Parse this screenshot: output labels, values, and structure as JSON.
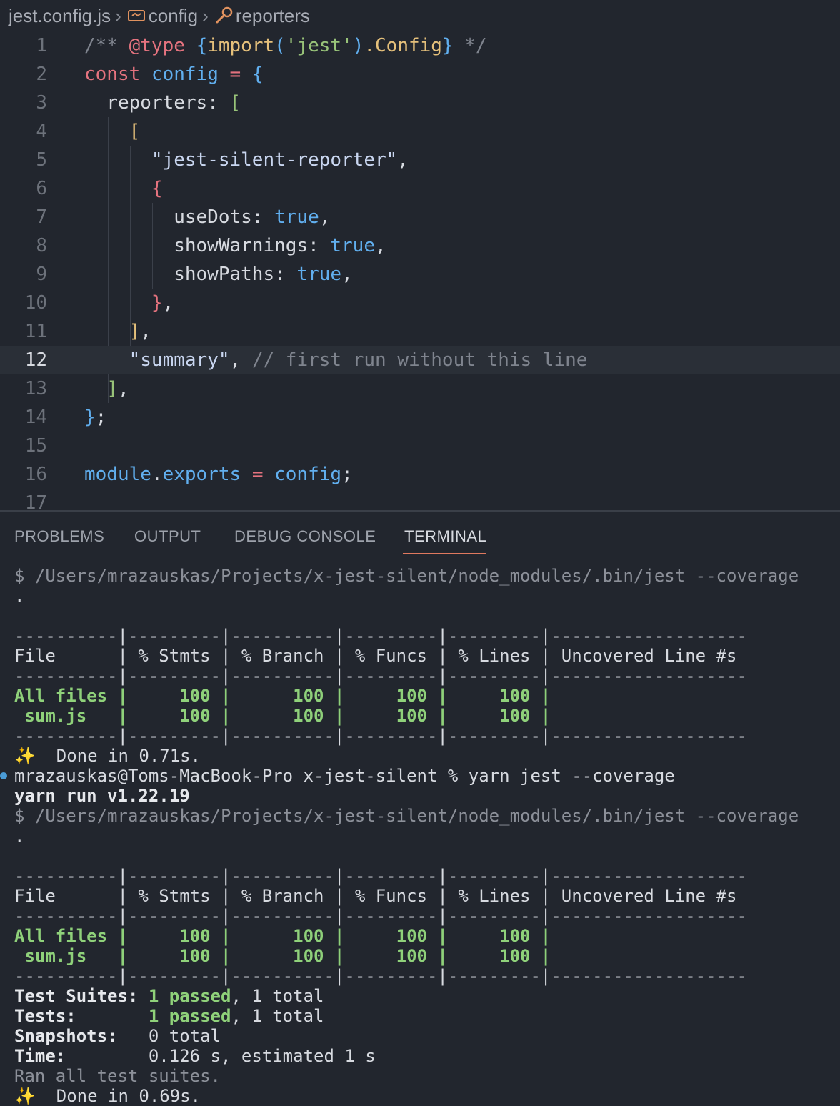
{
  "breadcrumb": {
    "file": "jest.config.js",
    "symbol1": "config",
    "symbol2": "reporters",
    "file_icon": "file-icon",
    "variable_icon": "variable-icon",
    "property_icon": "wrench-icon"
  },
  "editor": {
    "current_line": 12,
    "lines": [
      {
        "n": "1",
        "tokens": [
          [
            "c-comment",
            "/** "
          ],
          [
            "c-tag",
            "@type"
          ],
          [
            "c-comment",
            " "
          ],
          [
            "c-brace",
            "{"
          ],
          [
            "c-type",
            "import"
          ],
          [
            "c-brace",
            "("
          ],
          [
            "c-str",
            "'jest'"
          ],
          [
            "c-brace",
            ")"
          ],
          [
            "c-type",
            ".Config"
          ],
          [
            "c-brace",
            "}"
          ],
          [
            "c-comment",
            " */"
          ]
        ]
      },
      {
        "n": "2",
        "tokens": [
          [
            "c-kw",
            "const"
          ],
          [
            "c-op",
            " "
          ],
          [
            "c-var",
            "config"
          ],
          [
            "c-op",
            " "
          ],
          [
            "c-kw",
            "="
          ],
          [
            "c-op",
            " "
          ],
          [
            "c-brace",
            "{"
          ]
        ]
      },
      {
        "n": "3",
        "tokens": [
          [
            "c-op",
            "  reporters: "
          ],
          [
            "c-br3",
            "["
          ]
        ]
      },
      {
        "n": "4",
        "tokens": [
          [
            "c-op",
            "    "
          ],
          [
            "c-br1",
            "["
          ]
        ]
      },
      {
        "n": "5",
        "tokens": [
          [
            "c-op",
            "      "
          ],
          [
            "c-strw",
            "\"jest-silent-reporter\""
          ],
          [
            "c-op",
            ","
          ]
        ]
      },
      {
        "n": "6",
        "tokens": [
          [
            "c-op",
            "      "
          ],
          [
            "c-br2",
            "{"
          ]
        ]
      },
      {
        "n": "7",
        "tokens": [
          [
            "c-prop",
            "        useDots: "
          ],
          [
            "c-bool",
            "true"
          ],
          [
            "c-op",
            ","
          ]
        ]
      },
      {
        "n": "8",
        "tokens": [
          [
            "c-prop",
            "        showWarnings: "
          ],
          [
            "c-bool",
            "true"
          ],
          [
            "c-op",
            ","
          ]
        ]
      },
      {
        "n": "9",
        "tokens": [
          [
            "c-prop",
            "        showPaths: "
          ],
          [
            "c-bool",
            "true"
          ],
          [
            "c-op",
            ","
          ]
        ]
      },
      {
        "n": "10",
        "tokens": [
          [
            "c-op",
            "      "
          ],
          [
            "c-br2",
            "}"
          ],
          [
            "c-op",
            ","
          ]
        ]
      },
      {
        "n": "11",
        "tokens": [
          [
            "c-op",
            "    "
          ],
          [
            "c-br1",
            "]"
          ],
          [
            "c-op",
            ","
          ]
        ]
      },
      {
        "n": "12",
        "tokens": [
          [
            "c-op",
            "    "
          ],
          [
            "c-strw",
            "\"summary\""
          ],
          [
            "c-op",
            ", "
          ],
          [
            "c-comment",
            "// first run without this line"
          ]
        ]
      },
      {
        "n": "13",
        "tokens": [
          [
            "c-op",
            "  "
          ],
          [
            "c-br3",
            "]"
          ],
          [
            "c-op",
            ","
          ]
        ]
      },
      {
        "n": "14",
        "tokens": [
          [
            "c-brace",
            "}"
          ],
          [
            "c-op",
            ";"
          ]
        ]
      },
      {
        "n": "15",
        "tokens": []
      },
      {
        "n": "16",
        "tokens": [
          [
            "c-var",
            "module"
          ],
          [
            "c-op",
            "."
          ],
          [
            "c-var",
            "exports"
          ],
          [
            "c-op",
            " "
          ],
          [
            "c-kw",
            "="
          ],
          [
            "c-op",
            " "
          ],
          [
            "c-var",
            "config"
          ],
          [
            "c-op",
            ";"
          ]
        ]
      },
      {
        "n": "17",
        "tokens": []
      }
    ]
  },
  "panel": {
    "tabs": [
      "PROBLEMS",
      "OUTPUT",
      "DEBUG CONSOLE",
      "TERMINAL"
    ],
    "active_tab": "TERMINAL"
  },
  "terminal": {
    "accent_green": "#8fd17a",
    "lines": [
      {
        "t": "dim",
        "text": "$ /Users/mrazauskas/Projects/x-jest-silent/node_modules/.bin/jest --coverage"
      },
      {
        "t": "plain",
        "text": "."
      },
      {
        "t": "plain",
        "text": ""
      },
      {
        "t": "plain",
        "text": "----------|---------|----------|---------|---------|-------------------"
      },
      {
        "t": "plain",
        "text": "File      | % Stmts | % Branch | % Funcs | % Lines | Uncovered Line #s"
      },
      {
        "t": "plain",
        "text": "----------|---------|----------|---------|---------|-------------------"
      },
      {
        "t": "green",
        "text": "All files |     100 |      100 |     100 |     100 |"
      },
      {
        "t": "green",
        "text": " sum.js   |     100 |      100 |     100 |     100 |"
      },
      {
        "t": "plain",
        "text": "----------|---------|----------|---------|---------|-------------------"
      },
      {
        "t": "plain",
        "text": "✨  Done in 0.71s."
      },
      {
        "t": "prompt",
        "text": "mrazauskas@Toms-MacBook-Pro x-jest-silent % yarn jest --coverage"
      },
      {
        "t": "bold",
        "text": "yarn run v1.22.19"
      },
      {
        "t": "dim",
        "text": "$ /Users/mrazauskas/Projects/x-jest-silent/node_modules/.bin/jest --coverage"
      },
      {
        "t": "plain",
        "text": "."
      },
      {
        "t": "plain",
        "text": ""
      },
      {
        "t": "plain",
        "text": "----------|---------|----------|---------|---------|-------------------"
      },
      {
        "t": "plain",
        "text": "File      | % Stmts | % Branch | % Funcs | % Lines | Uncovered Line #s"
      },
      {
        "t": "plain",
        "text": "----------|---------|----------|---------|---------|-------------------"
      },
      {
        "t": "green",
        "text": "All files |     100 |      100 |     100 |     100 |"
      },
      {
        "t": "green",
        "text": " sum.js   |     100 |      100 |     100 |     100 |"
      },
      {
        "t": "plain",
        "text": "----------|---------|----------|---------|---------|-------------------"
      },
      {
        "t": "summary",
        "label": "Test Suites: ",
        "passed": "1 passed",
        "rest": ", 1 total"
      },
      {
        "t": "summary",
        "label": "Tests:       ",
        "passed": "1 passed",
        "rest": ", 1 total"
      },
      {
        "t": "summary",
        "label": "Snapshots:   ",
        "passed": "",
        "rest": "0 total"
      },
      {
        "t": "summary",
        "label": "Time:        ",
        "passed": "",
        "rest": "0.126 s, estimated 1 s"
      },
      {
        "t": "dim",
        "text": "Ran all test suites."
      },
      {
        "t": "plain",
        "text": "✨  Done in 0.69s."
      }
    ]
  }
}
